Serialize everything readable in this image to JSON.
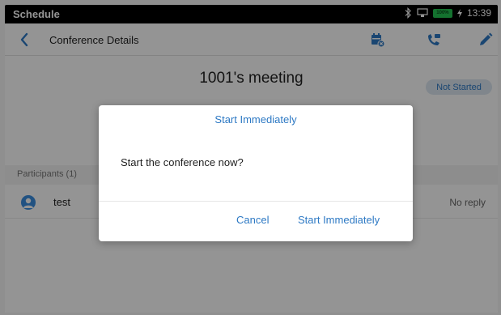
{
  "statusbar": {
    "app_name": "Schedule",
    "battery": "100%",
    "time": "13:39"
  },
  "header": {
    "title": "Conference Details"
  },
  "meeting": {
    "title": "1001's meeting",
    "status": "Not Started"
  },
  "participants": {
    "heading": "Participants (1)",
    "items": [
      {
        "name": "test",
        "status": "No reply"
      }
    ]
  },
  "dialog": {
    "title": "Start Immediately",
    "message": "Start the conference now?",
    "cancel_label": "Cancel",
    "confirm_label": "Start Immediately"
  },
  "colors": {
    "accent": "#2d79c4",
    "statusbar_bg": "#000000",
    "battery": "#23c552",
    "badge_bg": "#dde7f2"
  },
  "icons": [
    "bluetooth-icon",
    "network-icon",
    "battery-icon",
    "charging-icon",
    "back-icon",
    "calendar-cancel-icon",
    "phone-call-icon",
    "edit-icon",
    "avatar-icon"
  ]
}
